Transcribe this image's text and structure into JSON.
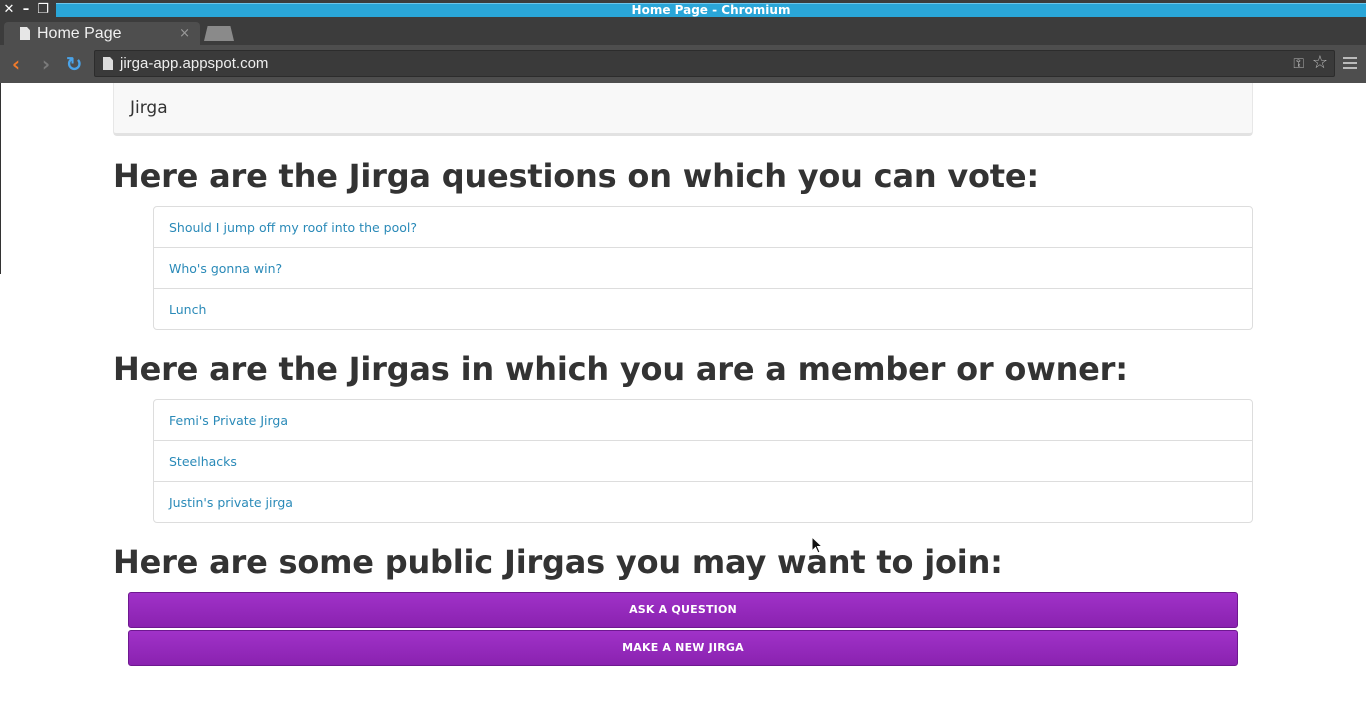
{
  "window": {
    "title": "Home Page - Chromium",
    "controls": [
      "close-icon",
      "minimize-icon",
      "restore-icon"
    ]
  },
  "tabs": [
    {
      "label": "Home Page",
      "close": "×"
    }
  ],
  "toolbar": {
    "url": "jirga-app.appspot.com"
  },
  "navbar": {
    "brand": "Jirga"
  },
  "sections": {
    "questions_heading": "Here are the Jirga questions on which you can vote:",
    "questions": [
      "Should I jump off my roof into the pool?",
      "Who's gonna win?",
      "Lunch"
    ],
    "jirgas_heading": "Here are the Jirgas in which you are a member or owner:",
    "jirgas": [
      "Femi's Private Jirga",
      "Steelhacks",
      "Justin's private jirga"
    ],
    "public_heading": "Here are some public Jirgas you may want to join:"
  },
  "actions": {
    "ask_label": "ASK A QUESTION",
    "new_jirga_label": "MAKE A NEW JIRGA"
  },
  "colors": {
    "accent_button": "#9a2cc0",
    "link": "#2a8ab8",
    "title_bar": "#2aa6d8"
  }
}
